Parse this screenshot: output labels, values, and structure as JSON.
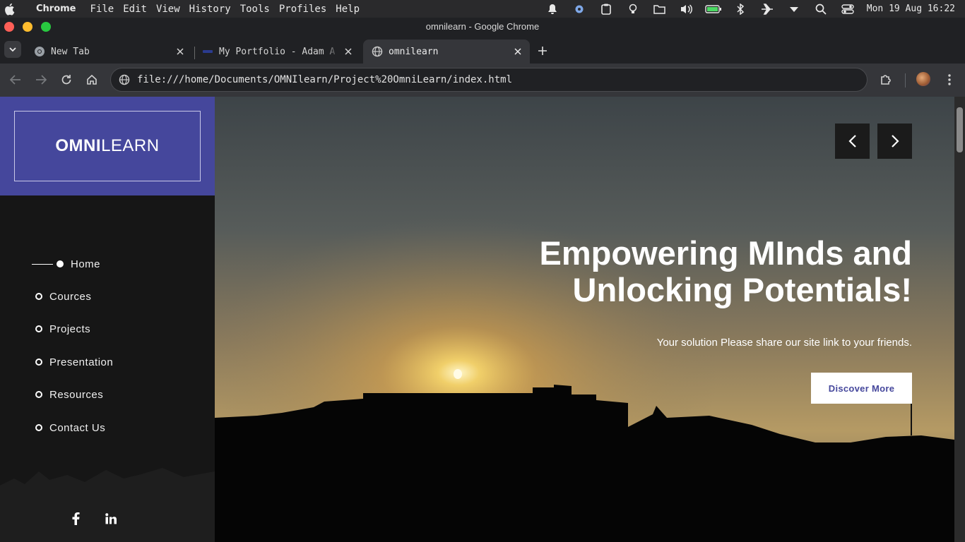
{
  "menubar": {
    "app_name": "Chrome",
    "menus": [
      "File",
      "Edit",
      "View",
      "History",
      "Tools",
      "Profiles",
      "Help"
    ],
    "clock": "Mon 19 Aug 16:22",
    "status_icons": [
      "notification-bell-icon",
      "settings-gear-icon",
      "clipboard-icon",
      "lightbulb-icon",
      "folder-sync-icon",
      "volume-icon",
      "battery-icon",
      "bluetooth-icon",
      "airplane-icon",
      "wifi-dropdown-icon",
      "search-icon",
      "control-center-icon"
    ]
  },
  "window": {
    "title": "omnilearn - Google Chrome",
    "traffic_colors": [
      "#ff5f57",
      "#febc2e",
      "#28c840"
    ]
  },
  "tabs": [
    {
      "title": "New Tab",
      "icon": "chrome-icon",
      "active": false
    },
    {
      "title": "My Portfolio - Adam A",
      "icon": "portfolio-favicon",
      "active": false
    },
    {
      "title": "omnilearn",
      "icon": "globe-icon",
      "active": true
    }
  ],
  "toolbar": {
    "url": "file:///home/Documents/OMNIlearn/Project%20OmniLearn/index.html"
  },
  "site": {
    "logo_bold": "OMNI",
    "logo_light": "LEARN",
    "nav": [
      {
        "label": "Home",
        "active": true
      },
      {
        "label": "Cources",
        "active": false
      },
      {
        "label": "Projects",
        "active": false
      },
      {
        "label": "Presentation",
        "active": false
      },
      {
        "label": "Resources",
        "active": false
      },
      {
        "label": "Contact Us",
        "active": false
      }
    ],
    "social": [
      "facebook-icon",
      "linkedin-icon"
    ],
    "hero": {
      "headline_line1": "Empowering MInds and",
      "headline_line2": "Unlocking Potentials!",
      "subtitle": "Your solution Please share our site link to your friends.",
      "cta": "Discover More"
    },
    "colors": {
      "brand": "#45479c",
      "sidebar": "#161616"
    }
  }
}
